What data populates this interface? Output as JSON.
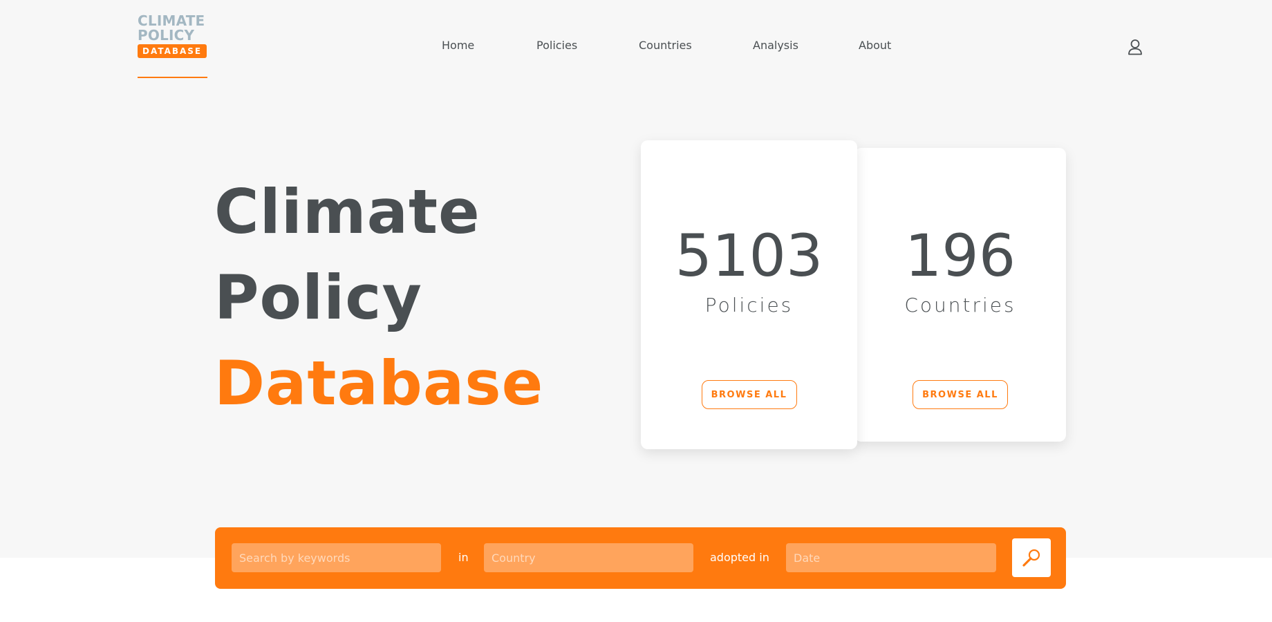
{
  "logo": {
    "line1": "CLIMATE",
    "line2": "POLICY",
    "badge": "DATABASE"
  },
  "nav": {
    "items": [
      {
        "label": "Home"
      },
      {
        "label": "Policies"
      },
      {
        "label": "Countries"
      },
      {
        "label": "Analysis"
      },
      {
        "label": "About"
      }
    ],
    "user_icon": "user-icon"
  },
  "hero": {
    "title_line1": "Climate",
    "title_line2": "Policy",
    "title_line3": "Database"
  },
  "cards": [
    {
      "number": "5103",
      "label": "Policies",
      "button": "BROWSE ALL"
    },
    {
      "number": "196",
      "label": "Countries",
      "button": "BROWSE ALL"
    }
  ],
  "search": {
    "keywords_placeholder": "Search by keywords",
    "in_label": "in",
    "country_placeholder": "Country",
    "adopted_label": "adopted in",
    "date_placeholder": "Date",
    "button_icon": "search-icon"
  },
  "colors": {
    "accent": "#ff7a0f",
    "text_dark": "#4a4f52",
    "logo_gray_blue": "#a3b7c2",
    "hero_background": "#f7f7f7"
  }
}
